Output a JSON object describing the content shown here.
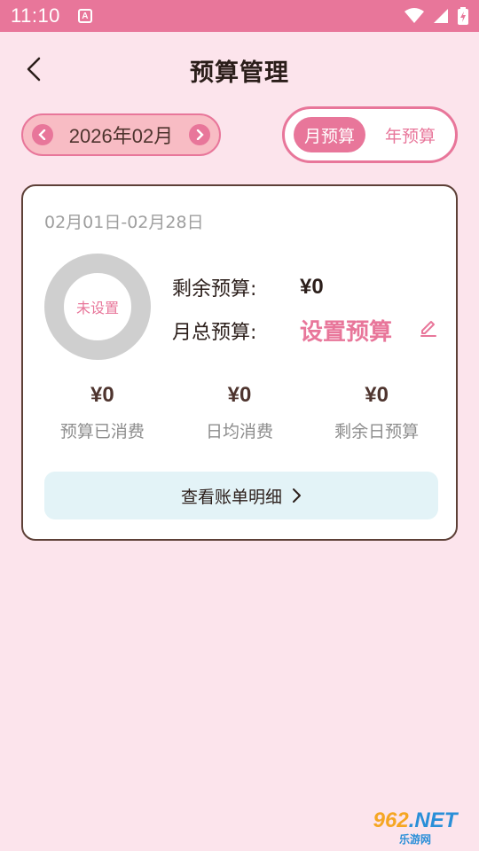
{
  "status_bar": {
    "time": "11:10",
    "notification_icon": "A"
  },
  "header": {
    "title": "预算管理"
  },
  "month_selector": {
    "month": "2026年02月",
    "prev_icon": "chevron-left",
    "next_icon": "chevron-right"
  },
  "budget_type": {
    "monthly": "月预算",
    "yearly": "年预算",
    "selected": "monthly"
  },
  "card": {
    "range": "02月01日-02月28日",
    "donut_label": "未设置",
    "remaining_label": "剩余预算:",
    "remaining_value": "¥0",
    "total_label": "月总预算:",
    "total_action": "设置预算",
    "stats": [
      {
        "value": "¥0",
        "caption": "预算已消费"
      },
      {
        "value": "¥0",
        "caption": "日均消费"
      },
      {
        "value": "¥0",
        "caption": "剩余日预算"
      }
    ],
    "detail_button": "查看账单明细"
  },
  "watermark": {
    "brand": "962",
    "brand_suffix": ".NET",
    "sub": "乐游网"
  },
  "colors": {
    "accent": "#e8769a",
    "background": "#fce4ec",
    "pill_bg": "#f8bcc4",
    "detail_bg": "#e3f3f7"
  }
}
